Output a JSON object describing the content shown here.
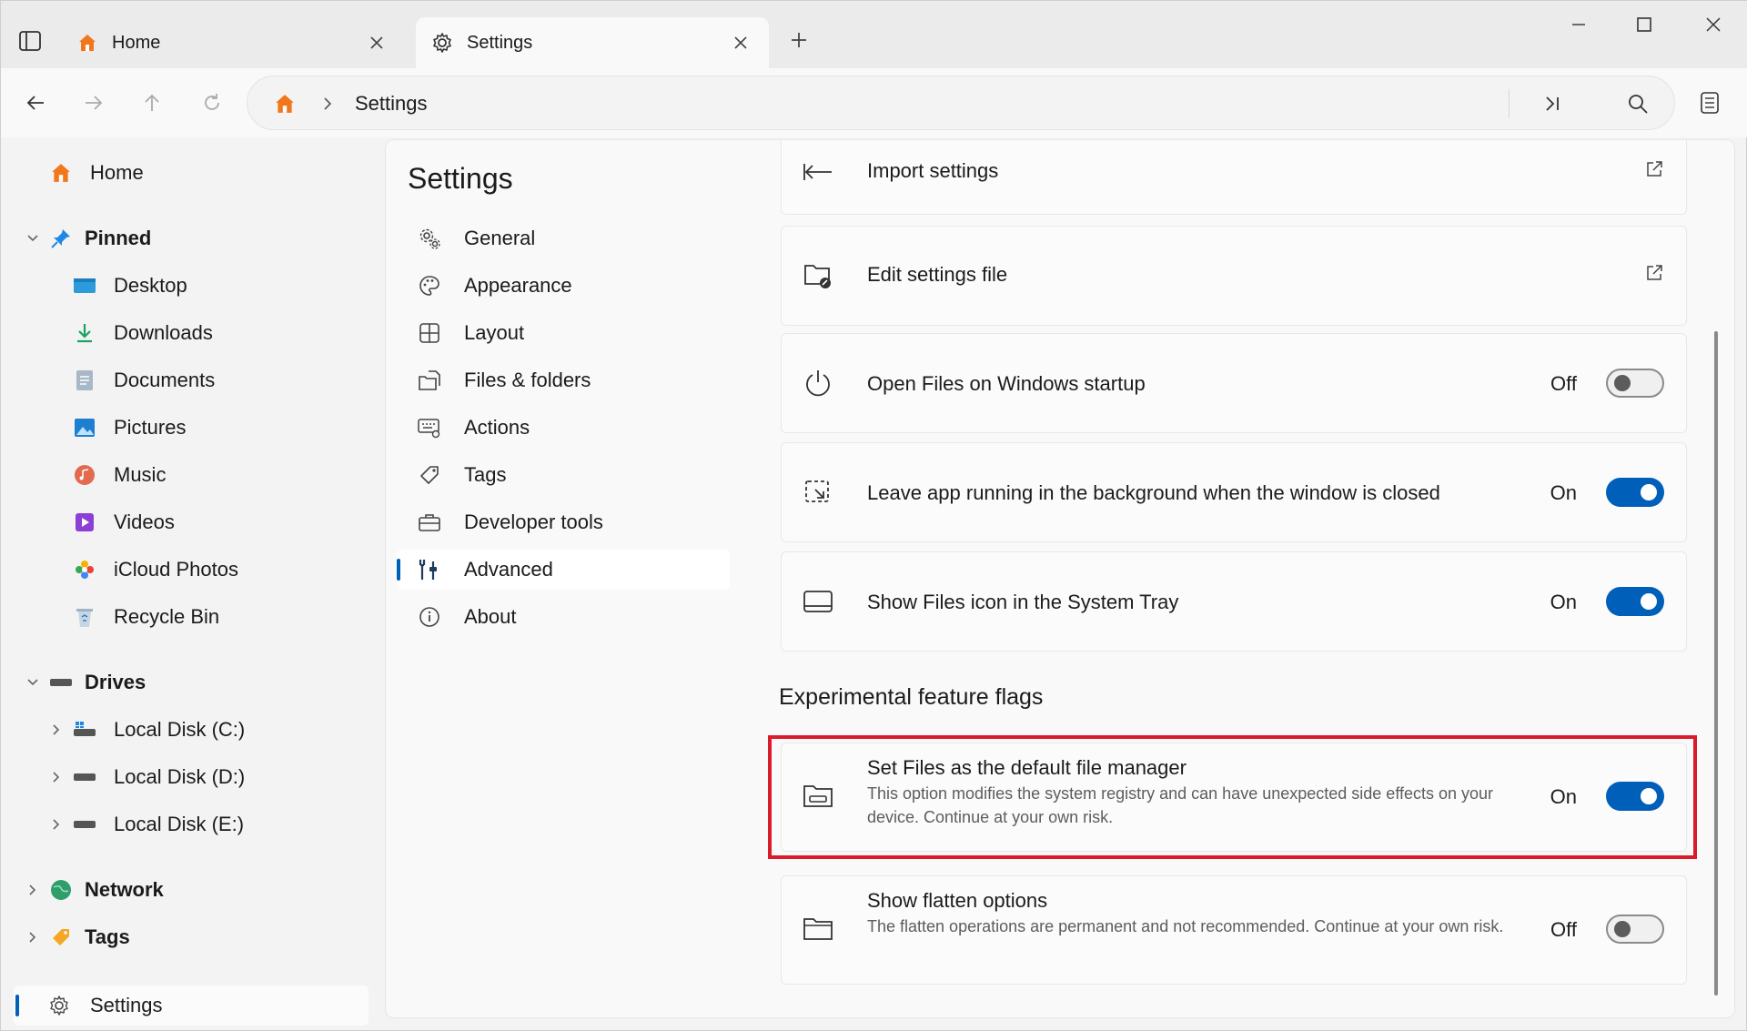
{
  "colors": {
    "accent": "#005fb8",
    "highlight": "#d91b2a",
    "home_icon": "#f2761c"
  },
  "tabs": [
    {
      "label": "Home",
      "icon": "home-icon",
      "active": false
    },
    {
      "label": "Settings",
      "icon": "gear-icon",
      "active": true
    }
  ],
  "address": {
    "breadcrumb": "Settings"
  },
  "sidebar": {
    "home": "Home",
    "pinned": {
      "label": "Pinned",
      "items": [
        "Desktop",
        "Downloads",
        "Documents",
        "Pictures",
        "Music",
        "Videos",
        "iCloud Photos",
        "Recycle Bin"
      ]
    },
    "drives": {
      "label": "Drives",
      "items": [
        "Local Disk (C:)",
        "Local Disk (D:)",
        "Local Disk (E:)"
      ]
    },
    "network": "Network",
    "tags": "Tags",
    "settings": "Settings"
  },
  "settings": {
    "title": "Settings",
    "nav": [
      {
        "label": "General",
        "icon": "general-settings-icon"
      },
      {
        "label": "Appearance",
        "icon": "palette-icon"
      },
      {
        "label": "Layout",
        "icon": "layout-grid-icon"
      },
      {
        "label": "Files & folders",
        "icon": "files-folders-icon"
      },
      {
        "label": "Actions",
        "icon": "keyboard-gear-icon"
      },
      {
        "label": "Tags",
        "icon": "tag-icon"
      },
      {
        "label": "Developer tools",
        "icon": "toolbox-icon"
      },
      {
        "label": "Advanced",
        "icon": "sliders-icon",
        "selected": true
      },
      {
        "label": "About",
        "icon": "info-icon"
      }
    ],
    "cards": {
      "import": {
        "title": "Import settings"
      },
      "edit": {
        "title": "Edit settings file"
      },
      "startup": {
        "title": "Open Files on Windows startup",
        "state": "Off"
      },
      "background": {
        "title": "Leave app running in the background when the window is closed",
        "state": "On"
      },
      "tray": {
        "title": "Show Files icon in the System Tray",
        "state": "On"
      }
    },
    "experimental": {
      "heading": "Experimental feature flags",
      "default_manager": {
        "title": "Set Files as the default file manager",
        "description": "This option modifies the system registry and can have unexpected side effects on your device. Continue at your own risk.",
        "state": "On"
      },
      "flatten": {
        "title": "Show flatten options",
        "description": "The flatten operations are permanent and not recommended. Continue at your own risk.",
        "state": "Off"
      }
    }
  }
}
